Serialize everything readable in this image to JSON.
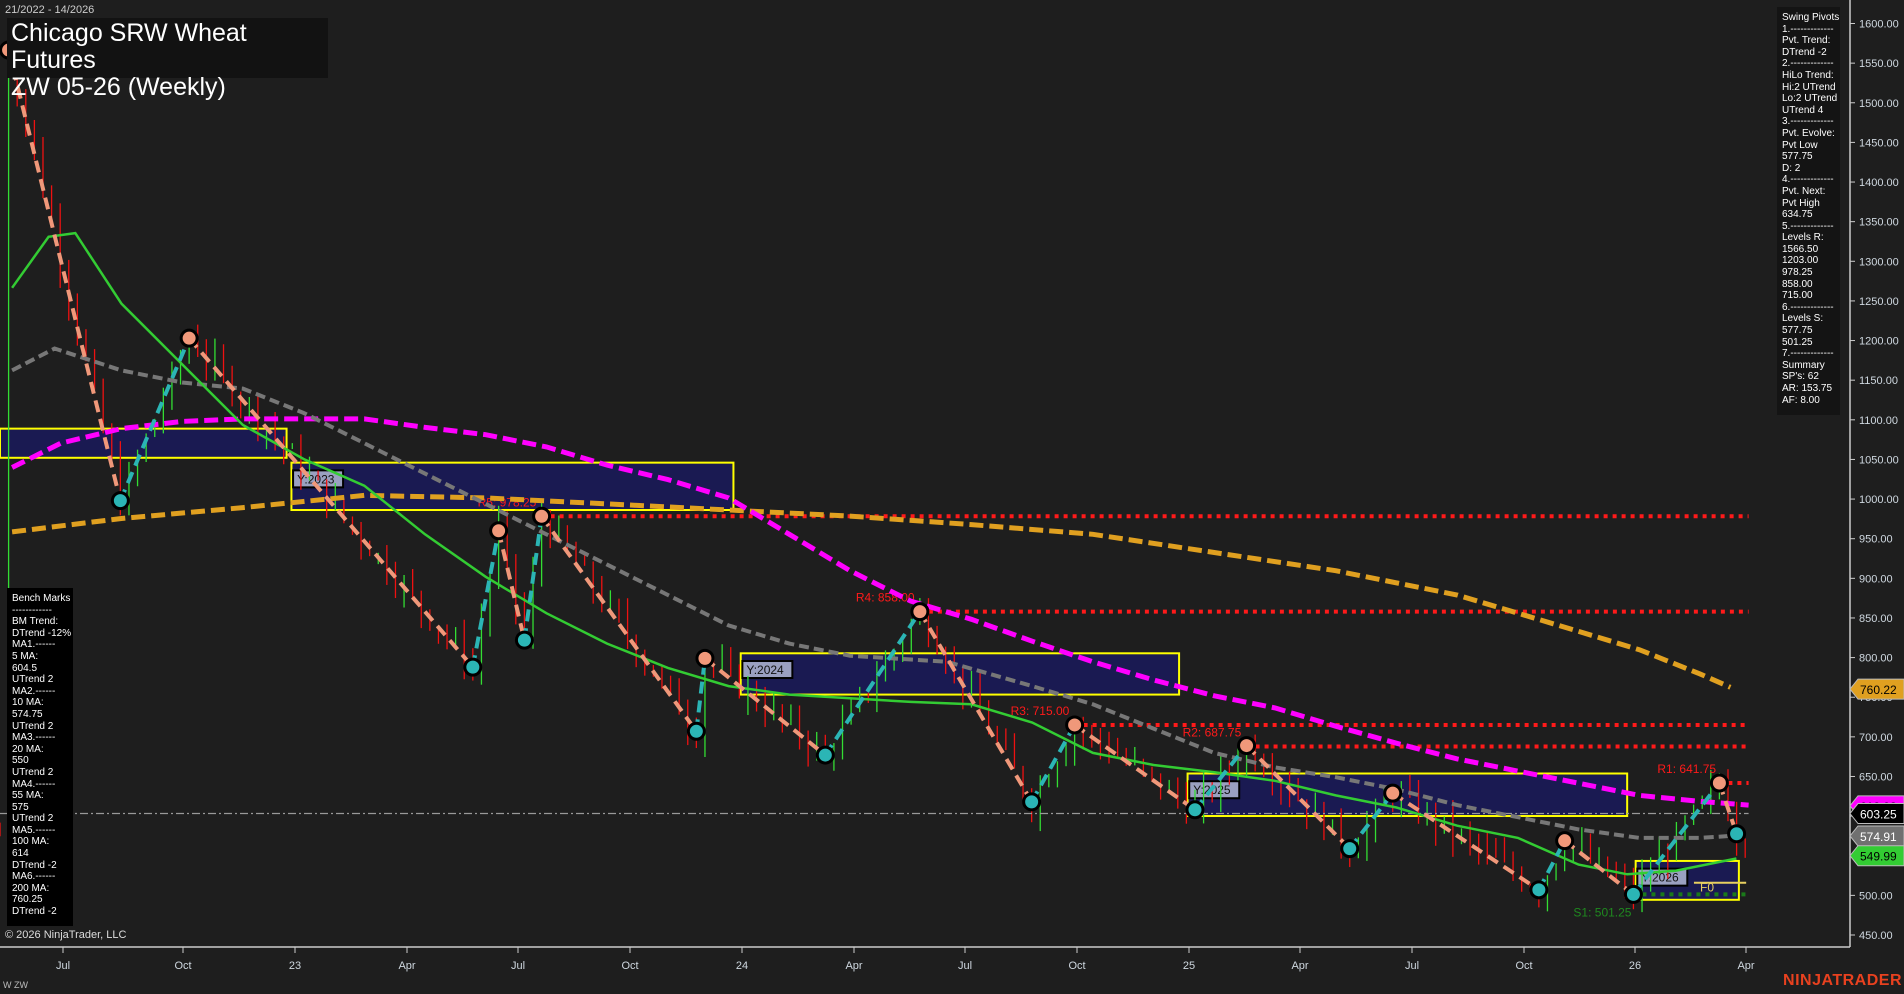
{
  "header": {
    "date_range": "21/2022 - 14/2026",
    "title_line1": "Chicago SRW Wheat Futures",
    "title_line2": "ZW 05-26 (Weekly)"
  },
  "swing_pivots_panel": [
    "Swing Pivots",
    "1.-------------",
    "Pvt. Trend:",
    "DTrend -2",
    "2.-------------",
    "HiLo Trend:",
    "Hi:2 UTrend",
    "Lo:2 UTrend",
    "UTrend 4",
    "3.-------------",
    "Pvt. Evolve:",
    "Pvt Low",
    "577.75",
    "D: 2",
    "4.-------------",
    "Pvt. Next:",
    "Pvt High",
    "634.75",
    "5.-------------",
    "Levels R:",
    "1566.50",
    "1203.00",
    "978.25",
    "858.00",
    "715.00",
    "6.-------------",
    "Levels S:",
    "577.75",
    "501.25",
    "7.-------------",
    "Summary",
    "SP's: 62",
    "AR: 153.75",
    "AF: 8.00"
  ],
  "bench_marks_panel": [
    "Bench Marks",
    "------------",
    "BM Trend:",
    "DTrend -12%",
    "MA1.------",
    "5 MA:",
    "604.5",
    "UTrend 2",
    "MA2.------",
    "10 MA:",
    "574.75",
    "UTrend 2",
    "MA3.------",
    "20 MA:",
    "550",
    "UTrend 2",
    "MA4.------",
    "55 MA:",
    "575",
    "UTrend 2",
    "MA5.------",
    "100 MA:",
    "614",
    "DTrend -2",
    "MA6.------",
    "200 MA:",
    "760.25",
    "DTrend -2"
  ],
  "footer": {
    "copyright": "© 2026 NinjaTrader, LLC",
    "instrument": "W ZW",
    "logo": "NINJATRADER"
  },
  "colors": {
    "background": "#1e1e1e",
    "ma20": "#33cc33",
    "ma55": "#777777",
    "ma100": "#ff00ff",
    "ma200": "#e0a020",
    "resistance": "#ff1a1a",
    "support": "#1a7a1a",
    "up_swing": "#2bb5b5",
    "down_swing": "#f0987a",
    "year_box": "#1a1a55",
    "year_border": "#ffff00"
  },
  "chart_data": {
    "type": "line",
    "title": "Chicago SRW Wheat Futures ZW 05-26 (Weekly)",
    "ylim": [
      450,
      1600
    ],
    "y_ticks": [
      "1600.00",
      "1550.00",
      "1500.00",
      "1450.00",
      "1400.00",
      "1350.00",
      "1300.00",
      "1250.00",
      "1200.00",
      "1150.00",
      "1100.00",
      "1050.00",
      "1000.00",
      "950.00",
      "900.00",
      "850.00",
      "800.00",
      "750.00",
      "700.00",
      "650.00",
      "600.00",
      "550.00",
      "500.00",
      "450.00"
    ],
    "x_ticks": [
      "Jul",
      "Oct",
      "23",
      "Apr",
      "Jul",
      "Oct",
      "24",
      "Apr",
      "Jul",
      "Oct",
      "25",
      "Apr",
      "Jul",
      "Oct",
      "26",
      "Apr"
    ],
    "price_markers": [
      {
        "label": "760.22",
        "value": 760.22,
        "color": "#e0a020"
      },
      {
        "label": "612.93",
        "value": 612.93,
        "color": "#ff00ff"
      },
      {
        "label": "603.25",
        "value": 603.25,
        "color": "#000000"
      },
      {
        "label": "574.91",
        "value": 574.91,
        "color": "#707070"
      },
      {
        "label": "549.99",
        "value": 549.99,
        "color": "#33cc33"
      }
    ],
    "levels": [
      {
        "label": "R5: 978.25",
        "value": 978.25,
        "start_week": 63,
        "type": "R"
      },
      {
        "label": "R4: 858.00",
        "value": 858.0,
        "start_week": 107,
        "type": "R"
      },
      {
        "label": "R3: 715.00",
        "value": 715.0,
        "start_week": 125,
        "type": "R"
      },
      {
        "label": "R2: 687.75",
        "value": 687.75,
        "start_week": 145,
        "type": "R"
      },
      {
        "label": "R1: 641.75",
        "value": 641.75,
        "start_week": 200,
        "type": "R"
      },
      {
        "label": "S1: 501.25",
        "value": 501.25,
        "start_week": 190,
        "type": "S"
      }
    ],
    "last_close": 603.25,
    "swing_pivots": [
      {
        "week": 1,
        "price": 1566.5,
        "kind": "H"
      },
      {
        "week": 14,
        "price": 998,
        "kind": "L"
      },
      {
        "week": 22,
        "price": 1203,
        "kind": "H"
      },
      {
        "week": 55,
        "price": 788,
        "kind": "L"
      },
      {
        "week": 58,
        "price": 960,
        "kind": "H"
      },
      {
        "week": 61,
        "price": 822,
        "kind": "L"
      },
      {
        "week": 63,
        "price": 978.25,
        "kind": "H"
      },
      {
        "week": 81,
        "price": 707,
        "kind": "L"
      },
      {
        "week": 82,
        "price": 799,
        "kind": "H"
      },
      {
        "week": 96,
        "price": 677,
        "kind": "L"
      },
      {
        "week": 107,
        "price": 858,
        "kind": "H"
      },
      {
        "week": 120,
        "price": 618,
        "kind": "L"
      },
      {
        "week": 125,
        "price": 715,
        "kind": "H"
      },
      {
        "week": 139,
        "price": 608,
        "kind": "L"
      },
      {
        "week": 145,
        "price": 689,
        "kind": "H"
      },
      {
        "week": 157,
        "price": 559,
        "kind": "L"
      },
      {
        "week": 162,
        "price": 629,
        "kind": "H"
      },
      {
        "week": 179,
        "price": 507,
        "kind": "L"
      },
      {
        "week": 182,
        "price": 569,
        "kind": "H"
      },
      {
        "week": 190,
        "price": 501.25,
        "kind": "L"
      },
      {
        "week": 200,
        "price": 641.75,
        "kind": "H"
      },
      {
        "week": 202,
        "price": 577.75,
        "kind": "L"
      }
    ],
    "year_boxes": [
      {
        "label": "Y:2023"
      },
      {
        "label": "Y:2024"
      },
      {
        "label": "Y:2025"
      },
      {
        "label": "Y:2026"
      }
    ],
    "f0_label": "F0"
  }
}
